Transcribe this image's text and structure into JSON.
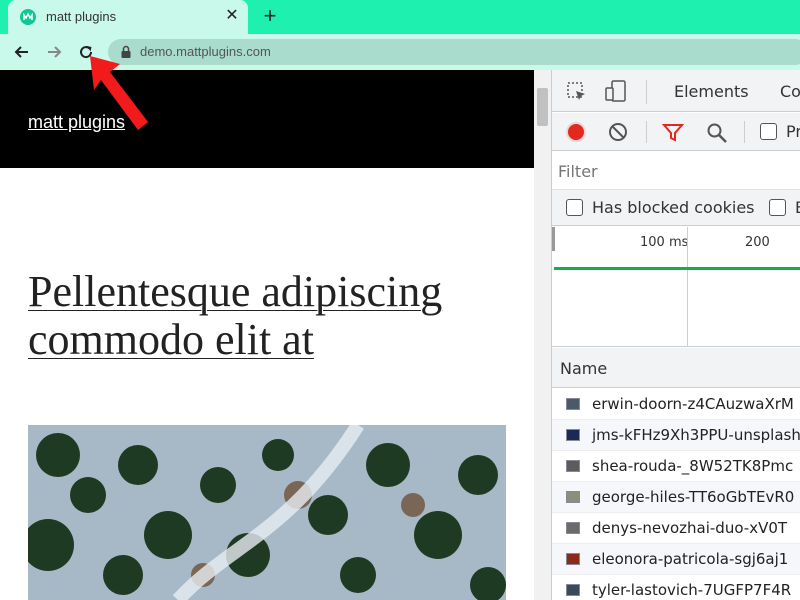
{
  "browser": {
    "tab_title": "matt plugins",
    "tab_close": "✕",
    "new_tab": "+",
    "url": "demo.mattplugins.com",
    "colors": {
      "tabbar": "#1ef0b0",
      "active_tab": "#c8f9ea",
      "omnibox": "#a9dccd"
    }
  },
  "page": {
    "site_title": "matt plugins",
    "post_title": "Pellentesque adipiscing commodo elit at"
  },
  "devtools": {
    "tabs": [
      "Elements",
      "Co"
    ],
    "toolbar_checkbox_label": "Pr",
    "filter_placeholder": "Filter",
    "has_blocked_cookies_label": "Has blocked cookies",
    "second_checkbox_label": "B",
    "timeline_labels": [
      "100 ms",
      "200"
    ],
    "column_header": "Name",
    "requests": [
      "erwin-doorn-z4CAuzwaXrM",
      "jms-kFHz9Xh3PPU-unsplash",
      "shea-rouda-_8W52TK8Pmc",
      "george-hiles-TT6oGbTEvR0",
      "denys-nevozhai-duo-xV0T",
      "eleonora-patricola-sgj6aj1",
      "tyler-lastovich-7UGFP7F4R"
    ]
  },
  "annotation": {
    "color": "#f21b1b",
    "icon": "arrow-pointing-reload"
  }
}
